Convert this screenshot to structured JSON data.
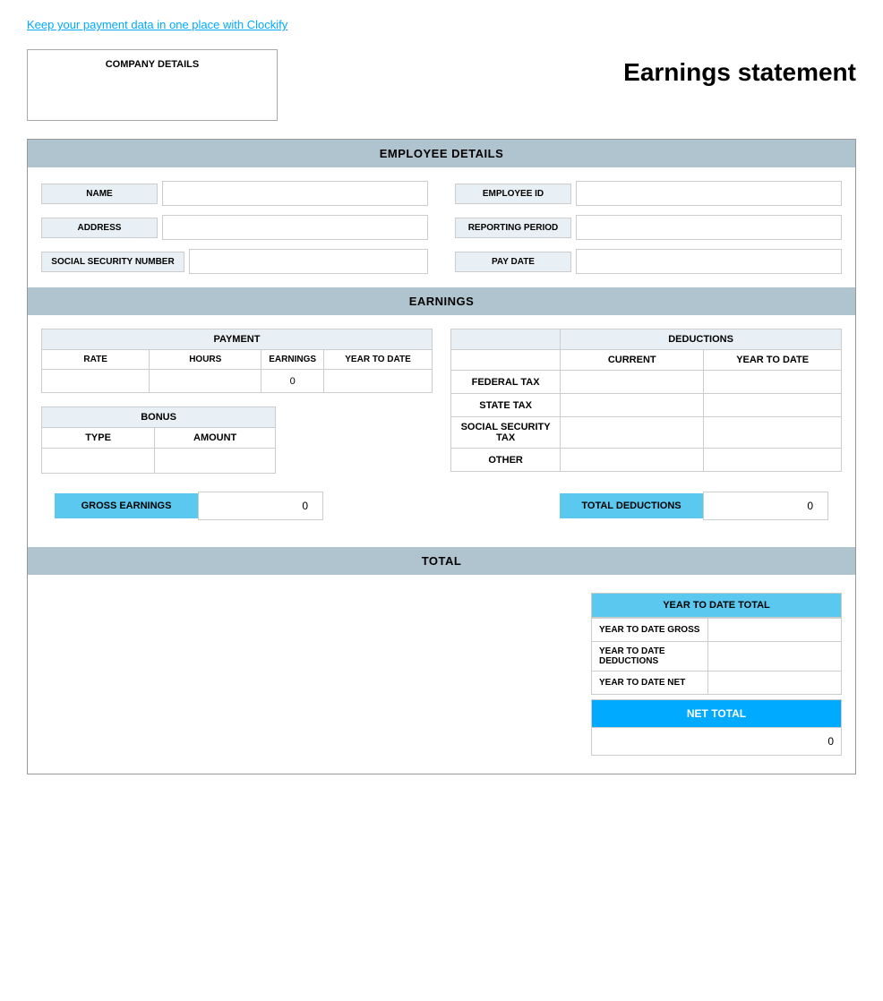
{
  "topLink": {
    "text": "Keep your payment data in one place with Clockify"
  },
  "header": {
    "companyLabel": "COMPANY DETAILS",
    "title": "Earnings statement"
  },
  "employeeDetails": {
    "sectionLabel": "EMPLOYEE DETAILS",
    "fields": {
      "name": {
        "label": "NAME",
        "value": ""
      },
      "address": {
        "label": "ADDRESS",
        "value": ""
      },
      "ssn": {
        "label": "SOCIAL SECURITY NUMBER",
        "value": ""
      },
      "employeeId": {
        "label": "EMPLOYEE ID",
        "value": ""
      },
      "reportingPeriod": {
        "label": "REPORTING PERIOD",
        "value": ""
      },
      "payDate": {
        "label": "PAY DATE",
        "value": ""
      }
    }
  },
  "earnings": {
    "sectionLabel": "EARNINGS",
    "payment": {
      "header": "PAYMENT",
      "columns": [
        "RATE",
        "HOURS",
        "EARNINGS",
        "YEAR TO DATE"
      ],
      "row": {
        "rate": "",
        "hours": "",
        "earnings": "0",
        "yearToDate": ""
      }
    },
    "bonus": {
      "header": "BONUS",
      "columns": [
        "TYPE",
        "AMOUNT"
      ],
      "row": {
        "type": "",
        "amount": ""
      }
    },
    "deductions": {
      "header": "DEDUCTIONS",
      "columns": [
        "CURRENT",
        "YEAR TO DATE"
      ],
      "rows": [
        {
          "label": "FEDERAL TAX",
          "current": "",
          "yearToDate": ""
        },
        {
          "label": "STATE TAX",
          "current": "",
          "yearToDate": ""
        },
        {
          "label": "SOCIAL SECURITY TAX",
          "current": "",
          "yearToDate": ""
        },
        {
          "label": "OTHER",
          "current": "",
          "yearToDate": ""
        }
      ]
    },
    "grossEarnings": {
      "label": "GROSS EARNINGS",
      "value": "0"
    },
    "totalDeductions": {
      "label": "TOTAL DEDUCTIONS",
      "value": "0"
    }
  },
  "total": {
    "sectionLabel": "TOTAL",
    "ytdTotal": {
      "header": "YEAR TO DATE TOTAL",
      "rows": [
        {
          "label": "YEAR TO DATE GROSS",
          "value": ""
        },
        {
          "label": "YEAR TO DATE DEDUCTIONS",
          "value": ""
        },
        {
          "label": "YEAR TO DATE NET",
          "value": ""
        }
      ]
    },
    "netTotal": {
      "label": "NET TOTAL",
      "value": "0"
    }
  }
}
